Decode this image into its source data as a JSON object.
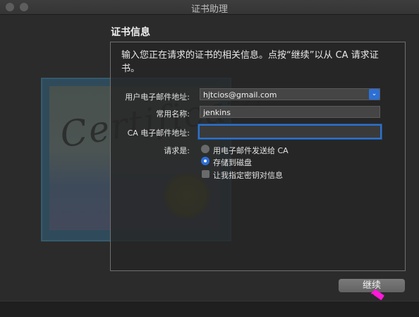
{
  "window": {
    "title": "证书助理"
  },
  "section": {
    "heading": "证书信息"
  },
  "intro": "输入您正在请求的证书的相关信息。点按“继续”以从 CA 请求证书。",
  "artwork": {
    "script_text": "Certificate"
  },
  "form": {
    "email_label": "用户电子邮件地址:",
    "email_value": "hjtcios@gmail.com",
    "common_name_label": "常用名称:",
    "common_name_value": "jenkins",
    "ca_email_label": "CA 电子邮件地址:",
    "ca_email_value": "",
    "request_label": "请求是:",
    "options": [
      {
        "label": "用电子邮件发送给 CA",
        "selected": false
      },
      {
        "label": "存储到磁盘",
        "selected": true
      }
    ],
    "checkbox_label": "让我指定密钥对信息",
    "checkbox_checked": false
  },
  "buttons": {
    "continue_label": "继续"
  },
  "colors": {
    "accent": "#2c6fd6",
    "cursor": "#ff18d9"
  }
}
